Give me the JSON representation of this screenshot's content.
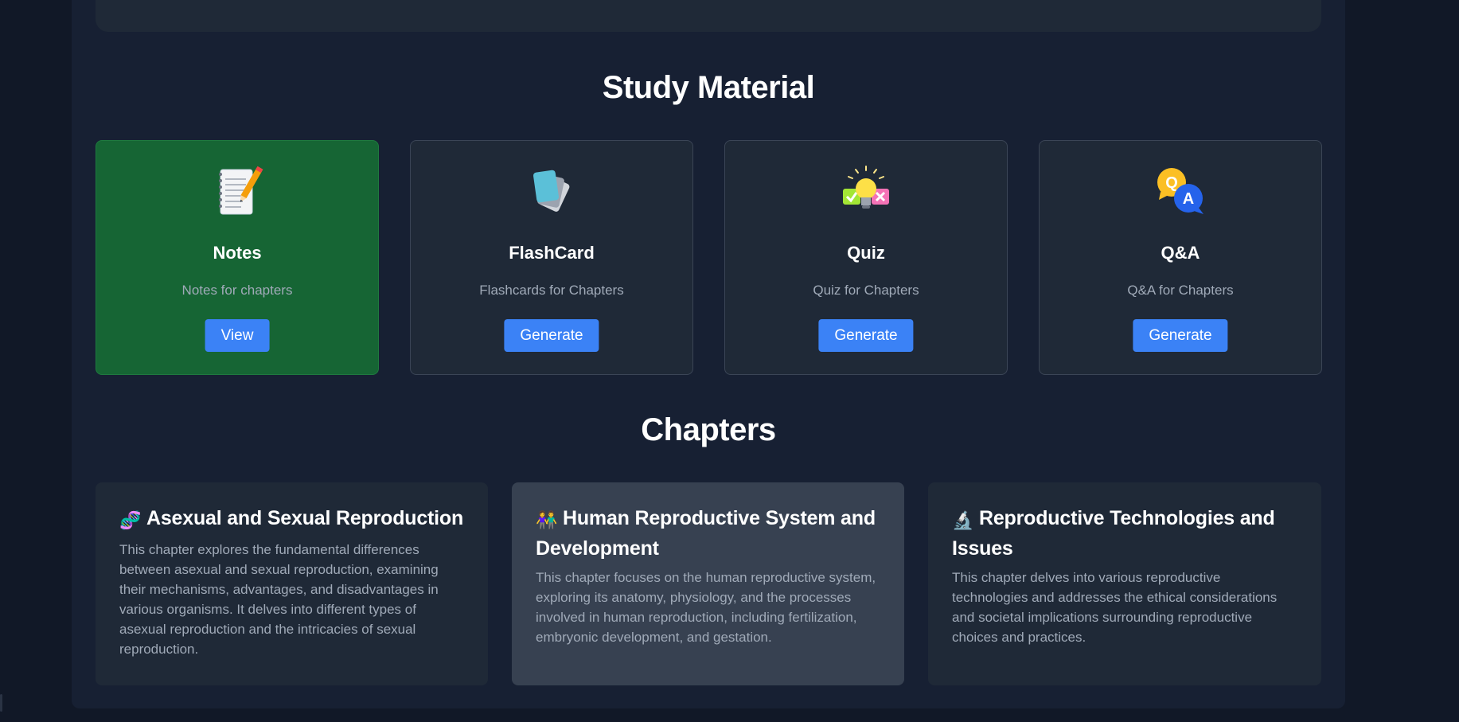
{
  "study_material": {
    "title": "Study Material",
    "cards": [
      {
        "title": "Notes",
        "description": "Notes for chapters",
        "button": "View",
        "icon": "notebook-icon",
        "active": true
      },
      {
        "title": "FlashCard",
        "description": "Flashcards for Chapters",
        "button": "Generate",
        "icon": "flashcards-icon"
      },
      {
        "title": "Quiz",
        "description": "Quiz for Chapters",
        "button": "Generate",
        "icon": "lightbulb-quiz-icon"
      },
      {
        "title": "Q&A",
        "description": "Q&A for Chapters",
        "button": "Generate",
        "icon": "qa-bubbles-icon"
      }
    ]
  },
  "chapters": {
    "title": "Chapters",
    "items": [
      {
        "emoji": "🧬",
        "icon": "dna-icon",
        "title": "Asexual and Sexual Reproduction",
        "description": "This chapter explores the fundamental differences between asexual and sexual reproduction, examining their mechanisms, advantages, and disadvantages in various organisms. It delves into different types of asexual reproduction and the intricacies of sexual reproduction."
      },
      {
        "emoji": "👫",
        "icon": "couple-icon",
        "title": "Human Reproductive System and Development",
        "description": "This chapter focuses on the human reproductive system, exploring its anatomy, physiology, and the processes involved in human reproduction, including fertilization, embryonic development, and gestation."
      },
      {
        "emoji": "🔬",
        "icon": "microscope-icon",
        "title": "Reproductive Technologies and Issues",
        "description": "This chapter delves into various reproductive technologies and addresses the ethical considerations and societal implications surrounding reproductive choices and practices."
      }
    ]
  },
  "colors": {
    "background": "#111827",
    "panel": "#172033",
    "card": "#1f2937",
    "active_card": "#166534",
    "highlight_card": "#374151",
    "button": "#3b82f6",
    "muted_text": "#a0aab8"
  }
}
